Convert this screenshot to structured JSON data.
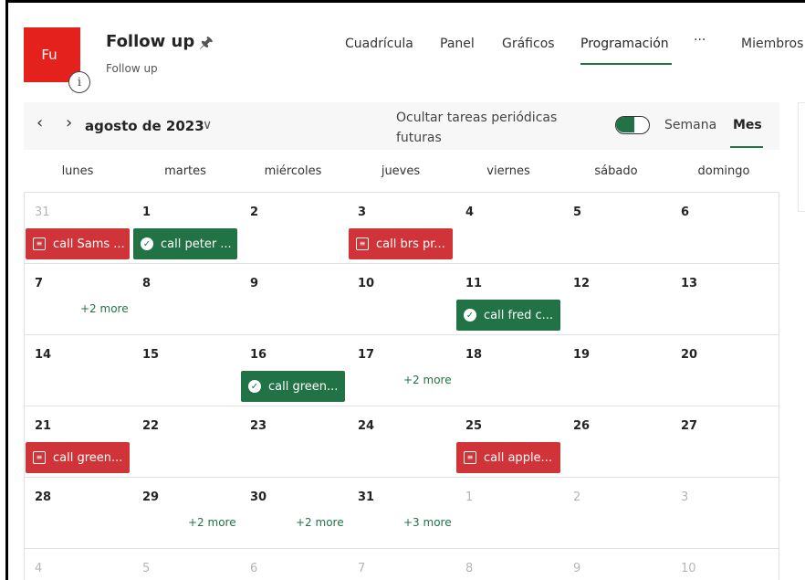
{
  "header": {
    "avatar_text": "Fu",
    "title": "Follow up",
    "subtitle": "Follow up",
    "nav": [
      "Cuadrícula",
      "Panel",
      "Gráficos",
      "Programación",
      "···",
      "Miembros"
    ],
    "active_nav": "Programación"
  },
  "toolbar": {
    "month": "agosto de 2023",
    "hide_recurring": "Ocultar tareas periódicas futuras",
    "hide_recurring_on": true,
    "view_week": "Semana",
    "view_month": "Mes",
    "active_view": "Mes"
  },
  "weekdays": [
    "lunes",
    "martes",
    "miércoles",
    "jueves",
    "viernes",
    "sábado",
    "domingo"
  ],
  "weeks": [
    {
      "days": [
        {
          "num": "31",
          "muted": true,
          "tasks": [
            {
              "label": "call Sams ...",
              "type": "calendar",
              "color": "#d13438"
            }
          ]
        },
        {
          "num": "1",
          "tasks": [
            {
              "label": "call peter ...",
              "type": "check",
              "color": "#217346"
            }
          ]
        },
        {
          "num": "2"
        },
        {
          "num": "3",
          "tasks": [
            {
              "label": "call brs pr...",
              "type": "calendar",
              "color": "#d13438"
            }
          ]
        },
        {
          "num": "4"
        },
        {
          "num": "5"
        },
        {
          "num": "6"
        }
      ]
    },
    {
      "days": [
        {
          "num": "7",
          "more": "+2 more"
        },
        {
          "num": "8"
        },
        {
          "num": "9"
        },
        {
          "num": "10"
        },
        {
          "num": "11",
          "tasks": [
            {
              "label": "call fred c...",
              "type": "check",
              "color": "#217346"
            }
          ]
        },
        {
          "num": "12"
        },
        {
          "num": "13"
        }
      ]
    },
    {
      "days": [
        {
          "num": "14"
        },
        {
          "num": "15"
        },
        {
          "num": "16",
          "tasks": [
            {
              "label": "call green...",
              "type": "check",
              "color": "#217346"
            }
          ]
        },
        {
          "num": "17",
          "more": "+2 more"
        },
        {
          "num": "18"
        },
        {
          "num": "19"
        },
        {
          "num": "20"
        }
      ]
    },
    {
      "days": [
        {
          "num": "21",
          "tasks": [
            {
              "label": "call green...",
              "type": "calendar",
              "color": "#d13438"
            }
          ]
        },
        {
          "num": "22"
        },
        {
          "num": "23"
        },
        {
          "num": "24"
        },
        {
          "num": "25",
          "tasks": [
            {
              "label": "call apple...",
              "type": "calendar",
              "color": "#d13438"
            }
          ]
        },
        {
          "num": "26"
        },
        {
          "num": "27"
        }
      ]
    },
    {
      "days": [
        {
          "num": "28"
        },
        {
          "num": "29",
          "more": "+2 more"
        },
        {
          "num": "30",
          "more": "+2 more"
        },
        {
          "num": "31",
          "more": "+3 more"
        },
        {
          "num": "1",
          "muted": true
        },
        {
          "num": "2",
          "muted": true
        },
        {
          "num": "3",
          "muted": true
        }
      ]
    },
    {
      "days": [
        {
          "num": "4",
          "muted": true
        },
        {
          "num": "5",
          "muted": true
        },
        {
          "num": "6",
          "muted": true
        },
        {
          "num": "7",
          "muted": true
        },
        {
          "num": "8",
          "muted": true
        },
        {
          "num": "9",
          "muted": true
        },
        {
          "num": "10",
          "muted": true
        }
      ]
    }
  ]
}
